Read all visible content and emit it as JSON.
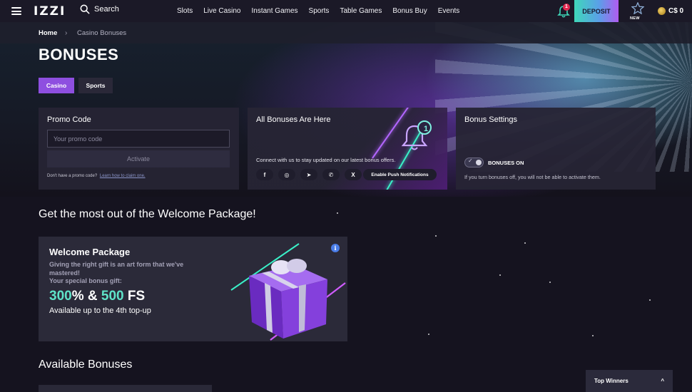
{
  "header": {
    "logo": "IZZI",
    "search_label": "Search",
    "nav": [
      "Slots",
      "Live Casino",
      "Instant Games",
      "Sports",
      "Table Games",
      "Bonus Buy",
      "Events"
    ],
    "notification_count": "1",
    "deposit_label": "DEPOSIT",
    "new_label": "NEW",
    "balance": "C$ 0"
  },
  "breadcrumb": {
    "home": "Home",
    "separator": "›",
    "current": "Casino Bonuses"
  },
  "page": {
    "title": "BONUSES",
    "tabs": [
      "Casino",
      "Sports"
    ],
    "active_tab": "Casino"
  },
  "promo": {
    "title": "Promo Code",
    "placeholder": "Your promo code",
    "value": "",
    "activate_label": "Activate",
    "note": "Don't have a promo code?",
    "note_link": "Learn how to claim one."
  },
  "all_bonuses": {
    "title": "All Bonuses Are Here",
    "badge": "1",
    "text": "Connect with us to stay updated on our latest bonus offers.",
    "socials": [
      {
        "icon": "facebook-icon",
        "glyph": "f"
      },
      {
        "icon": "instagram-icon",
        "glyph": "◎"
      },
      {
        "icon": "telegram-icon",
        "glyph": "➤"
      },
      {
        "icon": "whatsapp-icon",
        "glyph": "✆"
      },
      {
        "icon": "x-icon",
        "glyph": "X"
      }
    ],
    "push_label": "Enable Push Notifications"
  },
  "settings": {
    "title": "Bonus Settings",
    "toggle_label": "BONUSES ON",
    "toggle_on": true,
    "note": "If you turn bonuses off, you will not be able to activate them."
  },
  "welcome": {
    "section_title": "Get the most out of the Welcome Package!",
    "card_title": "Welcome Package",
    "desc_line1": "Giving the right gift is an art form that we've mastered!",
    "desc_line2": "Your special bonus gift:",
    "offer_pct": "300",
    "offer_mid": "% & ",
    "offer_fs": "500",
    "offer_suffix": " FS",
    "sub": "Available up to the 4th top-up",
    "info_glyph": "i"
  },
  "available": {
    "section_title": "Available Bonuses"
  },
  "top_winners": {
    "label": "Top Winners",
    "chevron": "^"
  },
  "colors": {
    "accent_purple": "#8e4fe0",
    "accent_teal": "#5fe3c8",
    "badge_red": "#e0284f"
  }
}
